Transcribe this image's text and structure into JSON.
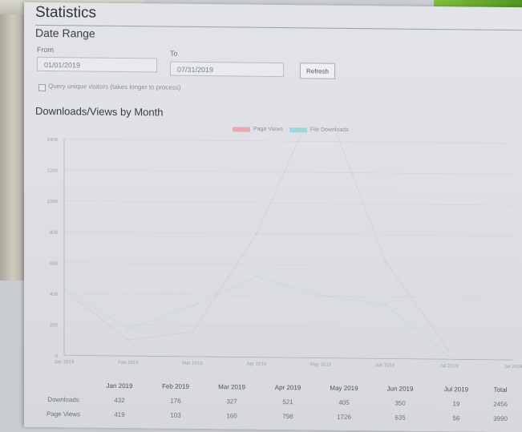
{
  "page": {
    "title": "Statistics",
    "date_range_heading": "Date Range"
  },
  "date_range": {
    "from_label": "From",
    "from_value": "01/01/2019",
    "to_label": "To",
    "to_value": "07/31/2019",
    "refresh_label": "Refresh",
    "unique_checkbox_label": "Query unique visitors (takes longer to process)"
  },
  "chart_section": {
    "heading": "Downloads/Views by Month"
  },
  "colors": {
    "page_views": "#e8a8b2",
    "downloads": "#9fd6dc"
  },
  "chart_data": {
    "type": "line",
    "legend": [
      "Page Views",
      "File Downloads"
    ],
    "y_ticks": [
      "1400",
      "1200",
      "1000",
      "800",
      "600",
      "400",
      "200",
      "0"
    ],
    "x_ticks": [
      "Jan 2019",
      "Feb 2019",
      "Mar 2019",
      "Apr 2019",
      "May 2019",
      "Jun 2019",
      "Jul 2019",
      "Jul 2019"
    ],
    "y_min": 0,
    "y_max": 1400,
    "series": [
      {
        "name": "Page Views",
        "values": [
          419,
          103,
          160,
          798,
          1726,
          635,
          56
        ]
      },
      {
        "name": "File Downloads",
        "values": [
          432,
          176,
          327,
          521,
          405,
          350,
          19
        ]
      }
    ]
  },
  "table": {
    "headers": [
      "",
      "Jan 2019",
      "Feb 2019",
      "Mar 2019",
      "Apr 2019",
      "May 2019",
      "Jun 2019",
      "Jul 2019",
      "Total"
    ],
    "rows": [
      {
        "label": "Downloads",
        "values": [
          "432",
          "176",
          "327",
          "521",
          "405",
          "350",
          "19",
          "2456"
        ]
      },
      {
        "label": "Page Views",
        "values": [
          "419",
          "103",
          "160",
          "798",
          "1726",
          "635",
          "56",
          "3990"
        ]
      }
    ]
  }
}
